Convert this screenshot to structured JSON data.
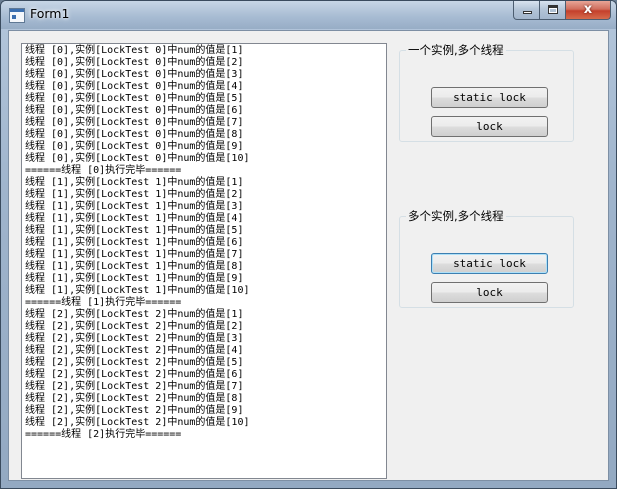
{
  "window": {
    "title": "Form1",
    "minimize_glyph": "",
    "close_glyph": "x"
  },
  "output": {
    "lines": [
      "线程 [0],实例[LockTest 0]中num的值是[1]",
      "线程 [0],实例[LockTest 0]中num的值是[2]",
      "线程 [0],实例[LockTest 0]中num的值是[3]",
      "线程 [0],实例[LockTest 0]中num的值是[4]",
      "线程 [0],实例[LockTest 0]中num的值是[5]",
      "线程 [0],实例[LockTest 0]中num的值是[6]",
      "线程 [0],实例[LockTest 0]中num的值是[7]",
      "线程 [0],实例[LockTest 0]中num的值是[8]",
      "线程 [0],实例[LockTest 0]中num的值是[9]",
      "线程 [0],实例[LockTest 0]中num的值是[10]",
      "======线程 [0]执行完毕======",
      "线程 [1],实例[LockTest 1]中num的值是[1]",
      "线程 [1],实例[LockTest 1]中num的值是[2]",
      "线程 [1],实例[LockTest 1]中num的值是[3]",
      "线程 [1],实例[LockTest 1]中num的值是[4]",
      "线程 [1],实例[LockTest 1]中num的值是[5]",
      "线程 [1],实例[LockTest 1]中num的值是[6]",
      "线程 [1],实例[LockTest 1]中num的值是[7]",
      "线程 [1],实例[LockTest 1]中num的值是[8]",
      "线程 [1],实例[LockTest 1]中num的值是[9]",
      "线程 [1],实例[LockTest 1]中num的值是[10]",
      "======线程 [1]执行完毕======",
      "线程 [2],实例[LockTest 2]中num的值是[1]",
      "线程 [2],实例[LockTest 2]中num的值是[2]",
      "线程 [2],实例[LockTest 2]中num的值是[3]",
      "线程 [2],实例[LockTest 2]中num的值是[4]",
      "线程 [2],实例[LockTest 2]中num的值是[5]",
      "线程 [2],实例[LockTest 2]中num的值是[6]",
      "线程 [2],实例[LockTest 2]中num的值是[7]",
      "线程 [2],实例[LockTest 2]中num的值是[8]",
      "线程 [2],实例[LockTest 2]中num的值是[9]",
      "线程 [2],实例[LockTest 2]中num的值是[10]",
      "======线程 [2]执行完毕======"
    ]
  },
  "group_single_instance": {
    "caption": "一个实例,多个线程",
    "static_lock_label": "static lock",
    "lock_label": "lock"
  },
  "group_multi_instance": {
    "caption": "多个实例,多个线程",
    "static_lock_label": "static lock",
    "lock_label": "lock"
  }
}
